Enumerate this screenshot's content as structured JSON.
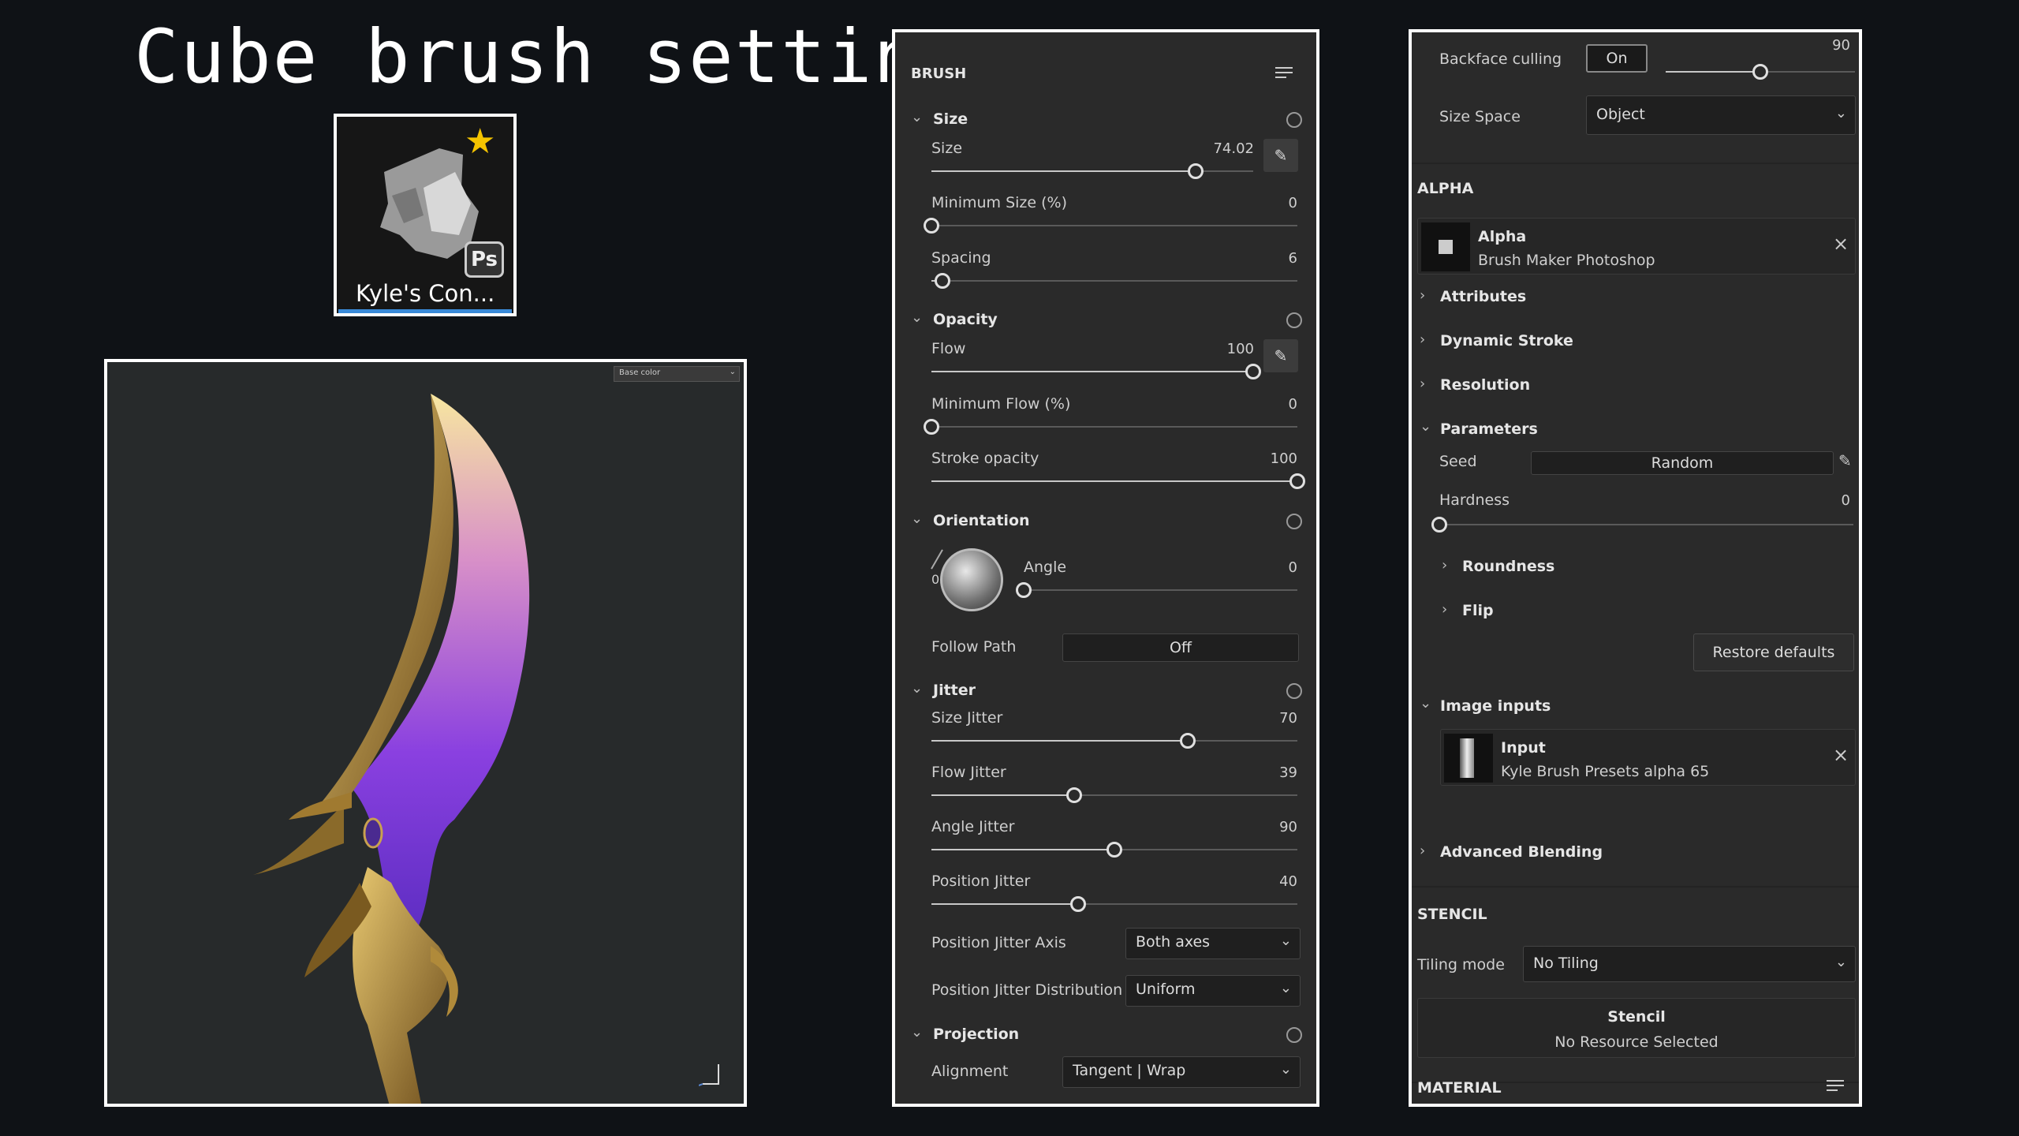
{
  "title": "Cube brush setting",
  "thumbnail": {
    "label": "Kyle's Con...",
    "badge": "Ps",
    "icon": "star-icon"
  },
  "viewport": {
    "channel": "Base color"
  },
  "brush": {
    "header": "BRUSH",
    "size": {
      "section": "Size",
      "size_label": "Size",
      "size_value": "74.02",
      "size_frac": 0.82,
      "min_label": "Minimum Size (%)",
      "min_value": "0",
      "min_frac": 0.0,
      "spacing_label": "Spacing",
      "spacing_value": "6",
      "spacing_frac": 0.03
    },
    "opacity": {
      "section": "Opacity",
      "flow_label": "Flow",
      "flow_value": "100",
      "flow_frac": 1.0,
      "min_label": "Minimum Flow (%)",
      "min_value": "0",
      "min_frac": 0.0,
      "stroke_label": "Stroke opacity",
      "stroke_value": "100",
      "stroke_frac": 1.0
    },
    "orientation": {
      "section": "Orientation",
      "angle_label": "Angle",
      "angle_value": "0",
      "angle_frac": 0.0,
      "dial_zero": "0",
      "follow_label": "Follow Path",
      "follow_value": "Off"
    },
    "jitter": {
      "section": "Jitter",
      "size_label": "Size Jitter",
      "size_value": "70",
      "size_frac": 0.7,
      "flow_label": "Flow Jitter",
      "flow_value": "39",
      "flow_frac": 0.39,
      "angle_label": "Angle Jitter",
      "angle_value": "90",
      "angle_frac": 0.5,
      "pos_label": "Position Jitter",
      "pos_value": "40",
      "pos_frac": 0.4,
      "axis_label": "Position Jitter Axis",
      "axis_value": "Both axes",
      "dist_label": "Position Jitter Distribution",
      "dist_value": "Uniform"
    },
    "projection": {
      "section": "Projection",
      "align_label": "Alignment",
      "align_value": "Tangent | Wrap"
    }
  },
  "right": {
    "backface_label": "Backface culling",
    "backface_toggle": "On",
    "backface_value": "90",
    "backface_frac": 0.5,
    "sizespace_label": "Size Space",
    "sizespace_value": "Object",
    "alpha_header": "ALPHA",
    "alpha_name": "Alpha",
    "alpha_resource": "Brush Maker Photoshop",
    "attributes": "Attributes",
    "dynamic_stroke": "Dynamic Stroke",
    "resolution": "Resolution",
    "parameters": "Parameters",
    "seed_label": "Seed",
    "seed_value": "Random",
    "hardness_label": "Hardness",
    "hardness_value": "0",
    "hardness_frac": 0.0,
    "roundness": "Roundness",
    "flip": "Flip",
    "restore": "Restore defaults",
    "image_inputs": "Image inputs",
    "input_name": "Input",
    "input_resource": "Kyle Brush Presets alpha 65",
    "advanced": "Advanced Blending",
    "stencil_header": "STENCIL",
    "tiling_label": "Tiling mode",
    "tiling_value": "No Tiling",
    "stencil_name": "Stencil",
    "stencil_resource": "No Resource Selected",
    "material_header": "MATERIAL"
  },
  "colors": {
    "panel": "#2a2a2a",
    "accent": "#3a8ad8",
    "star": "#f5c400"
  }
}
